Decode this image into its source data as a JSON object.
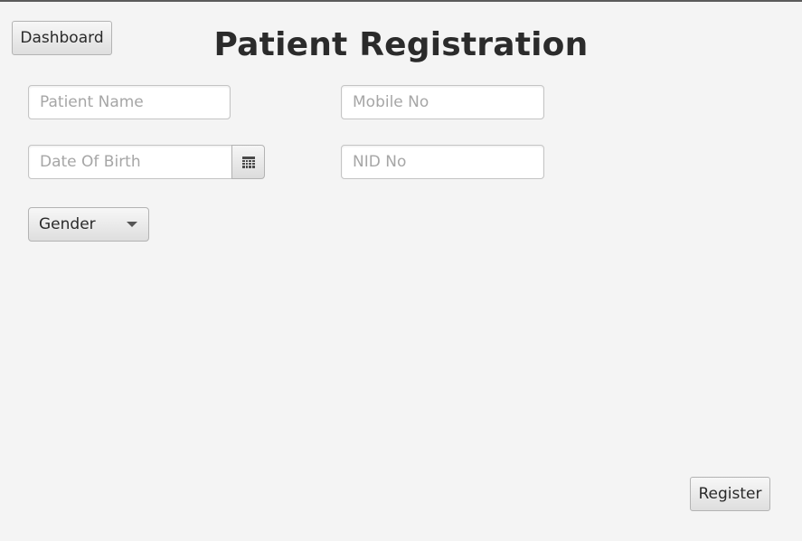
{
  "toolbar": {
    "dashboard_label": "Dashboard"
  },
  "page": {
    "title": "Patient Registration"
  },
  "form": {
    "patient_name": {
      "value": "",
      "placeholder": "Patient Name"
    },
    "mobile_no": {
      "value": "",
      "placeholder": "Mobile No"
    },
    "date_of_birth": {
      "value": "",
      "placeholder": "Date Of Birth"
    },
    "nid_no": {
      "value": "",
      "placeholder": "NID No"
    },
    "gender": {
      "selected": "Gender"
    },
    "register_label": "Register"
  },
  "icons": {
    "date_picker": "calendar-icon",
    "gender_dropdown": "chevron-down-icon"
  },
  "colors": {
    "background": "#f4f4f4",
    "title_text": "#2b2b2b",
    "placeholder": "#a6a6a6"
  }
}
